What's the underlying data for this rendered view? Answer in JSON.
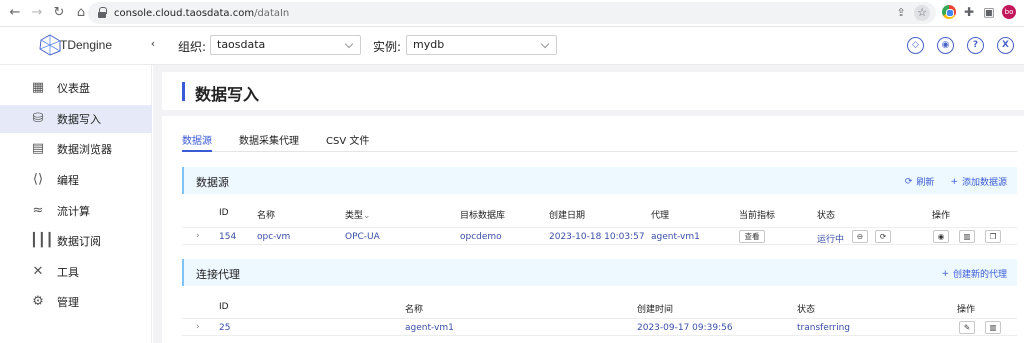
{
  "browser": {
    "url_host": "console.cloud.taosdata.com",
    "url_path": "/dataIn",
    "profile_initials": "bo"
  },
  "header": {
    "logo_text": "TDengine",
    "org_label": "组织:",
    "org_value": "taosdata",
    "instance_label": "实例:",
    "instance_value": "mydb",
    "icons": [
      "notification-icon",
      "theme-icon",
      "help-icon",
      "close-icon"
    ]
  },
  "sidebar": {
    "items": [
      {
        "label": "仪表盘",
        "icon": "dashboard-icon",
        "active": false
      },
      {
        "label": "数据写入",
        "icon": "data-in-icon",
        "active": true
      },
      {
        "label": "数据浏览器",
        "icon": "data-browser-icon",
        "active": false
      },
      {
        "label": "编程",
        "icon": "programming-icon",
        "active": false
      },
      {
        "label": "流计算",
        "icon": "stream-icon",
        "active": false
      },
      {
        "label": "数据订阅",
        "icon": "subscription-icon",
        "active": false
      },
      {
        "label": "工具",
        "icon": "tools-icon",
        "active": false
      },
      {
        "label": "管理",
        "icon": "management-icon",
        "active": false
      }
    ]
  },
  "page": {
    "title": "数据写入",
    "tabs": [
      {
        "label": "数据源",
        "active": true
      },
      {
        "label": "数据采集代理",
        "active": false
      },
      {
        "label": "CSV 文件",
        "active": false
      }
    ]
  },
  "datasource": {
    "section_title": "数据源",
    "refresh_label": "刷新",
    "add_label": "添加数据源",
    "columns": [
      "ID",
      "名称",
      "类型",
      "目标数据库",
      "创建日期",
      "代理",
      "当前指标",
      "状态",
      "操作"
    ],
    "rows": [
      {
        "id": "154",
        "name": "opc-vm",
        "type": "OPC-UA",
        "target_db": "opcdemo",
        "created": "2023-10-18 10:03:57",
        "agent": "agent-vm1",
        "metric_btn": "查看",
        "status": "运行中"
      }
    ]
  },
  "agents": {
    "section_title": "连接代理",
    "create_label": "创建新的代理",
    "columns": [
      "ID",
      "名称",
      "创建时间",
      "状态",
      "操作"
    ],
    "rows": [
      {
        "id": "25",
        "name": "agent-vm1",
        "created": "2023-09-17 09:39:56",
        "status": "transferring"
      }
    ]
  },
  "colors": {
    "accent": "#3b5bd6",
    "section_bg": "#eef8ff",
    "link": "#3a4fa8"
  }
}
